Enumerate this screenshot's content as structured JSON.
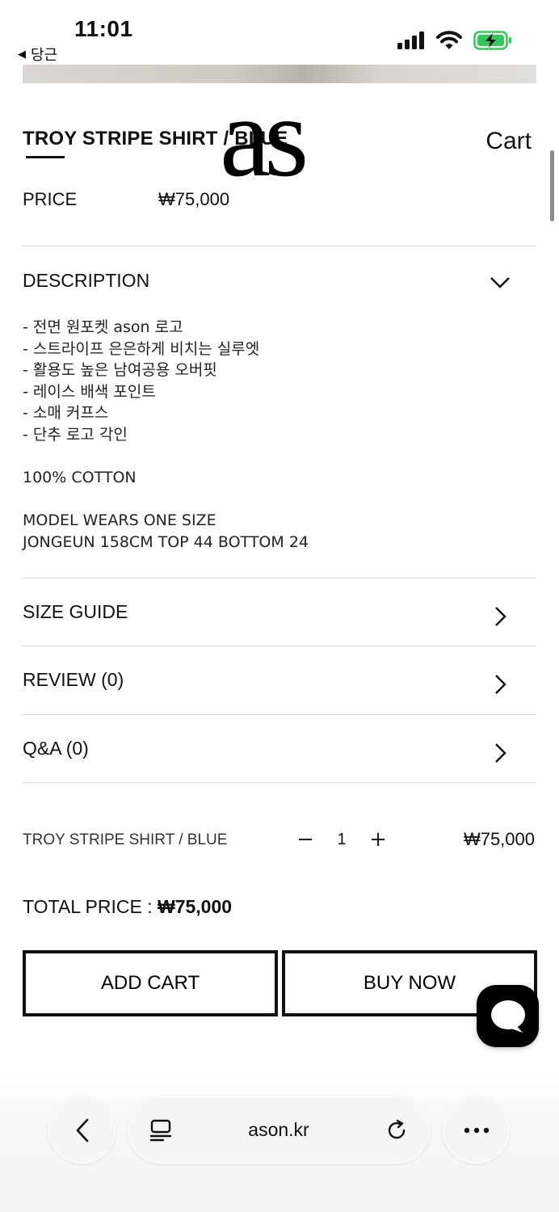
{
  "status_bar": {
    "time": "11:01",
    "back_app": "당근",
    "icons": [
      "signal-icon",
      "wifi-icon",
      "battery-charging-icon"
    ],
    "battery_color": "#34c759"
  },
  "header": {
    "product_title": "TROY STRIPE SHIRT / BLUE",
    "logo_text": "as",
    "cart_label": "Cart"
  },
  "price": {
    "label": "PRICE",
    "value": "₩75,000"
  },
  "description": {
    "title": "DESCRIPTION",
    "lines": [
      "- 전면 원포켓 ason 로고",
      "- 스트라이프 은은하게 비치는 실루엣",
      "- 활용도 높은 남여공용 오버핏",
      "- 레이스 배색 포인트",
      "- 소매 커프스",
      "- 단추 로고 각인"
    ],
    "material": "100% COTTON",
    "model_line1": "MODEL WEARS ONE SIZE",
    "model_line2": "JONGEUN 158CM TOP 44 BOTTOM 24"
  },
  "sections": {
    "size_guide": "SIZE GUIDE",
    "review": "REVIEW (0)",
    "qa": "Q&A (0)"
  },
  "order": {
    "item_name": "TROY STRIPE SHIRT / BLUE",
    "minus": "−",
    "quantity": "1",
    "plus": "+",
    "item_price": "₩75,000",
    "total_label": "TOTAL PRICE : ",
    "total_value": "₩75,000"
  },
  "buttons": {
    "add_cart": "ADD CART",
    "buy_now": "BUY NOW"
  },
  "browser": {
    "url": "ason.kr"
  }
}
